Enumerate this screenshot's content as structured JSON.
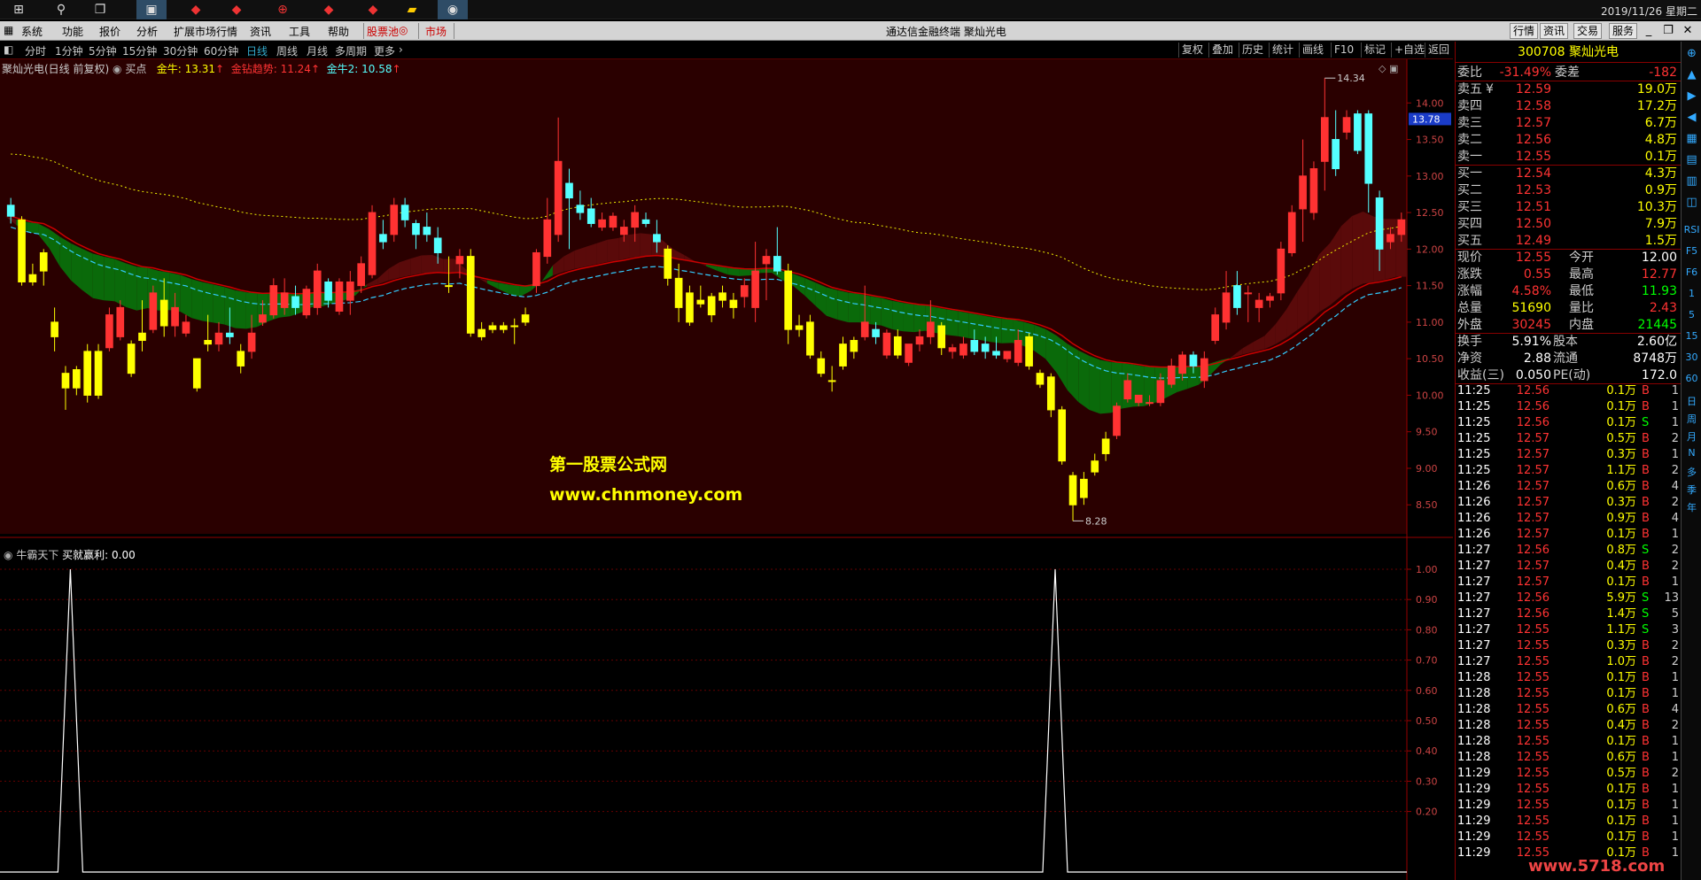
{
  "taskbar": {
    "clock": "2019/11/26 星期二"
  },
  "menubar": {
    "items": [
      "系统",
      "功能",
      "报价",
      "分析",
      "扩展市场行情",
      "资讯",
      "工具",
      "帮助",
      "股票池",
      "市场"
    ],
    "title": "通达信金融终端  聚灿光电",
    "right_buttons": [
      "行情",
      "资讯",
      "交易",
      "服务"
    ]
  },
  "periodbar": {
    "items": [
      "分时",
      "1分钟",
      "5分钟",
      "15分钟",
      "30分钟",
      "60分钟",
      "日线",
      "周线",
      "月线",
      "多周期",
      "更多"
    ],
    "active": "日线",
    "right_buttons": [
      "复权",
      "叠加",
      "历史",
      "统计",
      "画线",
      "F10",
      "标记",
      "+自选",
      "返回"
    ]
  },
  "chart": {
    "name": "聚灿光电(日线 前复权)",
    "buy_label": "买点",
    "jinniu": "金牛: 13.31",
    "jinzuan": "金钻趋势: 11.24",
    "jinniu2": "金牛2: 10.58",
    "price_axis": [
      "14.00",
      "13.50",
      "13.00",
      "12.50",
      "12.00",
      "11.50",
      "11.00",
      "10.50",
      "10.00",
      "9.50",
      "9.00",
      "8.50"
    ],
    "current_price_tag": "13.78",
    "high_label": "14.34",
    "low_label": "8.28",
    "watermark1": "第一股票公式网",
    "watermark2": "www.chnmoney.com"
  },
  "indicator": {
    "name": "牛霸天下",
    "label": "买就赢利: 0.00",
    "axis": [
      "1.00",
      "0.90",
      "0.80",
      "0.70",
      "0.60",
      "0.50",
      "0.40",
      "0.30",
      "0.20"
    ]
  },
  "colors": {
    "up": "#ff3232",
    "down": "#54ffff",
    "buy": "#ffff00",
    "accent": "#ffff00"
  },
  "quote": {
    "code": "300708  聚灿光电",
    "weibi": {
      "label": "委比",
      "value": "-31.49%",
      "label2": "委差",
      "value2": "-182"
    },
    "asks": [
      {
        "label": "卖五",
        "price": "12.59",
        "vol": "19.0万"
      },
      {
        "label": "卖四",
        "price": "12.58",
        "vol": "17.2万"
      },
      {
        "label": "卖三",
        "price": "12.57",
        "vol": "6.7万"
      },
      {
        "label": "卖二",
        "price": "12.56",
        "vol": "4.8万"
      },
      {
        "label": "卖一",
        "price": "12.55",
        "vol": "0.1万"
      }
    ],
    "ask_mark": "¥",
    "bids": [
      {
        "label": "买一",
        "price": "12.54",
        "vol": "4.3万"
      },
      {
        "label": "买二",
        "price": "12.53",
        "vol": "0.9万"
      },
      {
        "label": "买三",
        "price": "12.51",
        "vol": "10.3万"
      },
      {
        "label": "买四",
        "price": "12.50",
        "vol": "7.9万"
      },
      {
        "label": "买五",
        "price": "12.49",
        "vol": "1.5万"
      }
    ],
    "stats": [
      {
        "l1": "现价",
        "v1": "12.55",
        "c1": "#ff3232",
        "l2": "今开",
        "v2": "12.00",
        "c2": "#ffffff"
      },
      {
        "l1": "涨跌",
        "v1": "0.55",
        "c1": "#ff3232",
        "l2": "最高",
        "v2": "12.77",
        "c2": "#ff3232"
      },
      {
        "l1": "涨幅",
        "v1": "4.58%",
        "c1": "#ff3232",
        "l2": "最低",
        "v2": "11.93",
        "c2": "#00ff00"
      },
      {
        "l1": "总量",
        "v1": "51690",
        "c1": "#ffff00",
        "l2": "量比",
        "v2": "2.43",
        "c2": "#ff3232"
      },
      {
        "l1": "外盘",
        "v1": "30245",
        "c1": "#ff3232",
        "l2": "内盘",
        "v2": "21445",
        "c2": "#00ff00"
      }
    ],
    "stats2": [
      {
        "l1": "换手",
        "v1": "5.91%",
        "l2": "股本",
        "v2": "2.60亿"
      },
      {
        "l1": "净资",
        "v1": "2.88",
        "l2": "流通",
        "v2": "8748万"
      },
      {
        "l1": "收益(三)",
        "v1": "0.050",
        "l2": "PE(动)",
        "v2": "172.0"
      }
    ],
    "ticks": [
      [
        "11:25",
        "12.56",
        "0.1万",
        "B",
        "1"
      ],
      [
        "11:25",
        "12.56",
        "0.1万",
        "B",
        "1"
      ],
      [
        "11:25",
        "12.56",
        "0.1万",
        "S",
        "1"
      ],
      [
        "11:25",
        "12.57",
        "0.5万",
        "B",
        "2"
      ],
      [
        "11:25",
        "12.57",
        "0.3万",
        "B",
        "1"
      ],
      [
        "11:25",
        "12.57",
        "1.1万",
        "B",
        "2"
      ],
      [
        "11:26",
        "12.57",
        "0.6万",
        "B",
        "4"
      ],
      [
        "11:26",
        "12.57",
        "0.3万",
        "B",
        "2"
      ],
      [
        "11:26",
        "12.57",
        "0.9万",
        "B",
        "4"
      ],
      [
        "11:26",
        "12.57",
        "0.1万",
        "B",
        "1"
      ],
      [
        "11:27",
        "12.56",
        "0.8万",
        "S",
        "2"
      ],
      [
        "11:27",
        "12.57",
        "0.4万",
        "B",
        "2"
      ],
      [
        "11:27",
        "12.57",
        "0.1万",
        "B",
        "1"
      ],
      [
        "11:27",
        "12.56",
        "5.9万",
        "S",
        "13"
      ],
      [
        "11:27",
        "12.56",
        "1.4万",
        "S",
        "5"
      ],
      [
        "11:27",
        "12.55",
        "1.1万",
        "S",
        "3"
      ],
      [
        "11:27",
        "12.55",
        "0.3万",
        "B",
        "2"
      ],
      [
        "11:27",
        "12.55",
        "1.0万",
        "B",
        "2"
      ],
      [
        "11:28",
        "12.55",
        "0.1万",
        "B",
        "1"
      ],
      [
        "11:28",
        "12.55",
        "0.1万",
        "B",
        "1"
      ],
      [
        "11:28",
        "12.55",
        "0.6万",
        "B",
        "4"
      ],
      [
        "11:28",
        "12.55",
        "0.4万",
        "B",
        "2"
      ],
      [
        "11:28",
        "12.55",
        "0.1万",
        "B",
        "1"
      ],
      [
        "11:28",
        "12.55",
        "0.6万",
        "B",
        "1"
      ],
      [
        "11:29",
        "12.55",
        "0.5万",
        "B",
        "2"
      ],
      [
        "11:29",
        "12.55",
        "0.1万",
        "B",
        "1"
      ],
      [
        "11:29",
        "12.55",
        "0.1万",
        "B",
        "1"
      ],
      [
        "11:29",
        "12.55",
        "0.1万",
        "B",
        "1"
      ],
      [
        "11:29",
        "12.55",
        "0.1万",
        "B",
        "1"
      ],
      [
        "11:29",
        "12.55",
        "0.1万",
        "B",
        "1"
      ]
    ]
  },
  "toolbar_right": [
    "日",
    "周",
    "月",
    "N",
    "多",
    "季",
    "年"
  ],
  "toolbar_right2": [
    "RSI",
    "F5",
    "F6",
    "1",
    "5",
    "15",
    "30",
    "60"
  ],
  "corner_watermark": "www.5718.com",
  "chart_data": {
    "type": "candlestick",
    "candles": [
      [
        12.6,
        12.7,
        12.35,
        12.45
      ],
      [
        12.4,
        12.45,
        11.5,
        11.55
      ],
      [
        11.55,
        11.8,
        11.5,
        11.65
      ],
      [
        11.7,
        12.0,
        11.5,
        11.95
      ],
      [
        11.0,
        11.2,
        10.6,
        10.8
      ],
      [
        10.3,
        10.4,
        9.8,
        10.1
      ],
      [
        10.1,
        10.4,
        10.0,
        10.35
      ],
      [
        10.0,
        10.7,
        9.9,
        10.6
      ],
      [
        10.0,
        10.7,
        9.95,
        10.6
      ],
      [
        10.65,
        11.2,
        10.6,
        11.1
      ],
      [
        10.8,
        11.3,
        10.75,
        11.2
      ],
      [
        10.3,
        10.75,
        10.25,
        10.7
      ],
      [
        10.75,
        11.3,
        10.6,
        10.85
      ],
      [
        10.9,
        11.5,
        10.85,
        11.4
      ],
      [
        11.3,
        11.6,
        10.8,
        10.95
      ],
      [
        10.95,
        11.4,
        10.8,
        11.2
      ],
      [
        10.85,
        11.1,
        10.8,
        11.0
      ],
      [
        10.1,
        10.5,
        10.05,
        10.5
      ],
      [
        10.7,
        11.1,
        10.6,
        10.75
      ],
      [
        10.7,
        11.0,
        10.6,
        10.85
      ],
      [
        10.85,
        11.2,
        10.7,
        10.8
      ],
      [
        10.4,
        10.7,
        10.3,
        10.6
      ],
      [
        10.6,
        11.1,
        10.5,
        10.85
      ],
      [
        11.0,
        11.3,
        10.95,
        11.1
      ],
      [
        11.1,
        11.6,
        11.05,
        11.5
      ],
      [
        11.2,
        11.6,
        11.1,
        11.4
      ],
      [
        11.35,
        11.5,
        11.1,
        11.2
      ],
      [
        11.1,
        11.5,
        11.05,
        11.45
      ],
      [
        11.2,
        11.8,
        11.1,
        11.7
      ],
      [
        11.55,
        11.6,
        11.2,
        11.3
      ],
      [
        11.15,
        11.6,
        11.1,
        11.55
      ],
      [
        11.3,
        11.7,
        11.1,
        11.55
      ],
      [
        11.5,
        11.9,
        11.4,
        11.8
      ],
      [
        11.65,
        12.6,
        11.6,
        12.5
      ],
      [
        12.2,
        12.4,
        12.0,
        12.1
      ],
      [
        12.2,
        12.7,
        12.1,
        12.6
      ],
      [
        12.6,
        12.7,
        12.3,
        12.4
      ],
      [
        12.35,
        12.4,
        12.0,
        12.2
      ],
      [
        12.3,
        12.5,
        12.1,
        12.2
      ],
      [
        12.15,
        12.3,
        11.8,
        11.95
      ],
      [
        11.5,
        11.9,
        11.4,
        11.5
      ],
      [
        11.8,
        12.0,
        11.6,
        11.9
      ],
      [
        11.9,
        12.0,
        10.8,
        10.85
      ],
      [
        10.8,
        11.0,
        10.75,
        10.9
      ],
      [
        10.9,
        11.0,
        10.85,
        10.95
      ],
      [
        10.9,
        11.0,
        10.85,
        10.95
      ],
      [
        10.95,
        11.05,
        10.7,
        10.95
      ],
      [
        11.0,
        11.2,
        10.95,
        11.1
      ],
      [
        11.5,
        12.0,
        11.4,
        11.95
      ],
      [
        11.9,
        12.7,
        11.8,
        12.4
      ],
      [
        12.2,
        13.8,
        12.1,
        13.2
      ],
      [
        12.9,
        13.1,
        12.0,
        12.7
      ],
      [
        12.6,
        12.8,
        12.4,
        12.5
      ],
      [
        12.55,
        12.7,
        12.3,
        12.35
      ],
      [
        12.3,
        12.5,
        12.25,
        12.4
      ],
      [
        12.3,
        12.5,
        12.25,
        12.45
      ],
      [
        12.2,
        12.4,
        12.1,
        12.3
      ],
      [
        12.3,
        12.6,
        12.1,
        12.5
      ],
      [
        12.4,
        12.5,
        12.3,
        12.35
      ],
      [
        12.2,
        12.4,
        11.95,
        12.1
      ],
      [
        12.0,
        12.05,
        11.5,
        11.6
      ],
      [
        11.6,
        11.8,
        11.0,
        11.2
      ],
      [
        11.0,
        11.5,
        10.95,
        11.4
      ],
      [
        11.3,
        11.5,
        11.2,
        11.25
      ],
      [
        11.1,
        11.4,
        11.0,
        11.35
      ],
      [
        11.4,
        11.5,
        11.2,
        11.3
      ],
      [
        11.2,
        11.4,
        11.05,
        11.3
      ],
      [
        11.35,
        11.6,
        11.2,
        11.5
      ],
      [
        11.2,
        12.1,
        11.0,
        11.7
      ],
      [
        11.8,
        12.0,
        11.3,
        11.9
      ],
      [
        11.9,
        12.3,
        11.65,
        11.7
      ],
      [
        11.7,
        11.8,
        10.7,
        10.9
      ],
      [
        10.9,
        11.1,
        10.8,
        10.95
      ],
      [
        11.0,
        11.1,
        10.5,
        10.55
      ],
      [
        10.5,
        10.6,
        10.25,
        10.3
      ],
      [
        10.2,
        10.4,
        10.05,
        10.2
      ],
      [
        10.4,
        10.8,
        10.35,
        10.7
      ],
      [
        10.6,
        10.8,
        10.5,
        10.75
      ],
      [
        10.8,
        11.5,
        10.75,
        11.0
      ],
      [
        10.9,
        11.0,
        10.7,
        10.8
      ],
      [
        10.55,
        10.9,
        10.5,
        10.85
      ],
      [
        10.8,
        10.9,
        10.5,
        10.55
      ],
      [
        10.45,
        10.7,
        10.4,
        10.7
      ],
      [
        10.7,
        10.9,
        10.6,
        10.8
      ],
      [
        10.8,
        11.3,
        10.7,
        11.0
      ],
      [
        10.95,
        11.0,
        10.55,
        10.65
      ],
      [
        10.6,
        10.7,
        10.5,
        10.65
      ],
      [
        10.55,
        10.8,
        10.5,
        10.7
      ],
      [
        10.75,
        10.9,
        10.55,
        10.6
      ],
      [
        10.7,
        10.8,
        10.5,
        10.6
      ],
      [
        10.6,
        10.8,
        10.5,
        10.55
      ],
      [
        10.5,
        10.6,
        10.45,
        10.6
      ],
      [
        10.45,
        10.9,
        10.4,
        10.75
      ],
      [
        10.8,
        10.85,
        10.35,
        10.4
      ],
      [
        10.3,
        10.35,
        10.1,
        10.15
      ],
      [
        10.25,
        10.3,
        9.7,
        9.8
      ],
      [
        9.8,
        9.85,
        9.05,
        9.1
      ],
      [
        8.9,
        8.95,
        8.28,
        8.5
      ],
      [
        8.6,
        8.95,
        8.5,
        8.85
      ],
      [
        8.95,
        9.2,
        8.9,
        9.1
      ],
      [
        9.2,
        9.5,
        9.1,
        9.4
      ],
      [
        9.45,
        9.9,
        9.4,
        9.85
      ],
      [
        9.95,
        10.3,
        9.9,
        10.2
      ],
      [
        9.9,
        10.0,
        9.85,
        10.0
      ],
      [
        9.9,
        10.0,
        9.85,
        9.9
      ],
      [
        9.9,
        10.3,
        9.85,
        10.2
      ],
      [
        10.15,
        10.5,
        10.1,
        10.4
      ],
      [
        10.3,
        10.6,
        10.2,
        10.55
      ],
      [
        10.55,
        10.6,
        10.3,
        10.4
      ],
      [
        10.2,
        10.6,
        10.1,
        10.5
      ],
      [
        10.75,
        11.2,
        10.7,
        11.1
      ],
      [
        11.0,
        11.7,
        10.9,
        11.4
      ],
      [
        11.5,
        11.7,
        11.1,
        11.2
      ],
      [
        11.4,
        11.5,
        11.0,
        11.4
      ],
      [
        11.2,
        11.4,
        11.0,
        11.3
      ],
      [
        11.3,
        11.4,
        11.2,
        11.35
      ],
      [
        11.4,
        12.1,
        11.3,
        12.0
      ],
      [
        11.95,
        12.6,
        11.9,
        12.5
      ],
      [
        12.55,
        13.5,
        12.1,
        13.0
      ],
      [
        12.5,
        13.2,
        12.4,
        13.1
      ],
      [
        13.2,
        14.34,
        12.8,
        13.8
      ],
      [
        13.5,
        13.9,
        13.0,
        13.1
      ],
      [
        13.6,
        13.9,
        13.5,
        13.8
      ],
      [
        13.85,
        13.9,
        13.3,
        13.35
      ],
      [
        13.85,
        13.9,
        12.5,
        12.9
      ],
      [
        12.7,
        12.8,
        11.7,
        12.0
      ],
      [
        12.1,
        12.3,
        12.0,
        12.2
      ],
      [
        12.2,
        12.5,
        12.1,
        12.4
      ]
    ],
    "buy_signals": [
      0.08,
      0.7
    ],
    "indicator_peaks": [
      0.05,
      0.75
    ],
    "ylim": [
      8.2,
      14.5
    ],
    "indicator_ylim": [
      0,
      1.0
    ]
  }
}
